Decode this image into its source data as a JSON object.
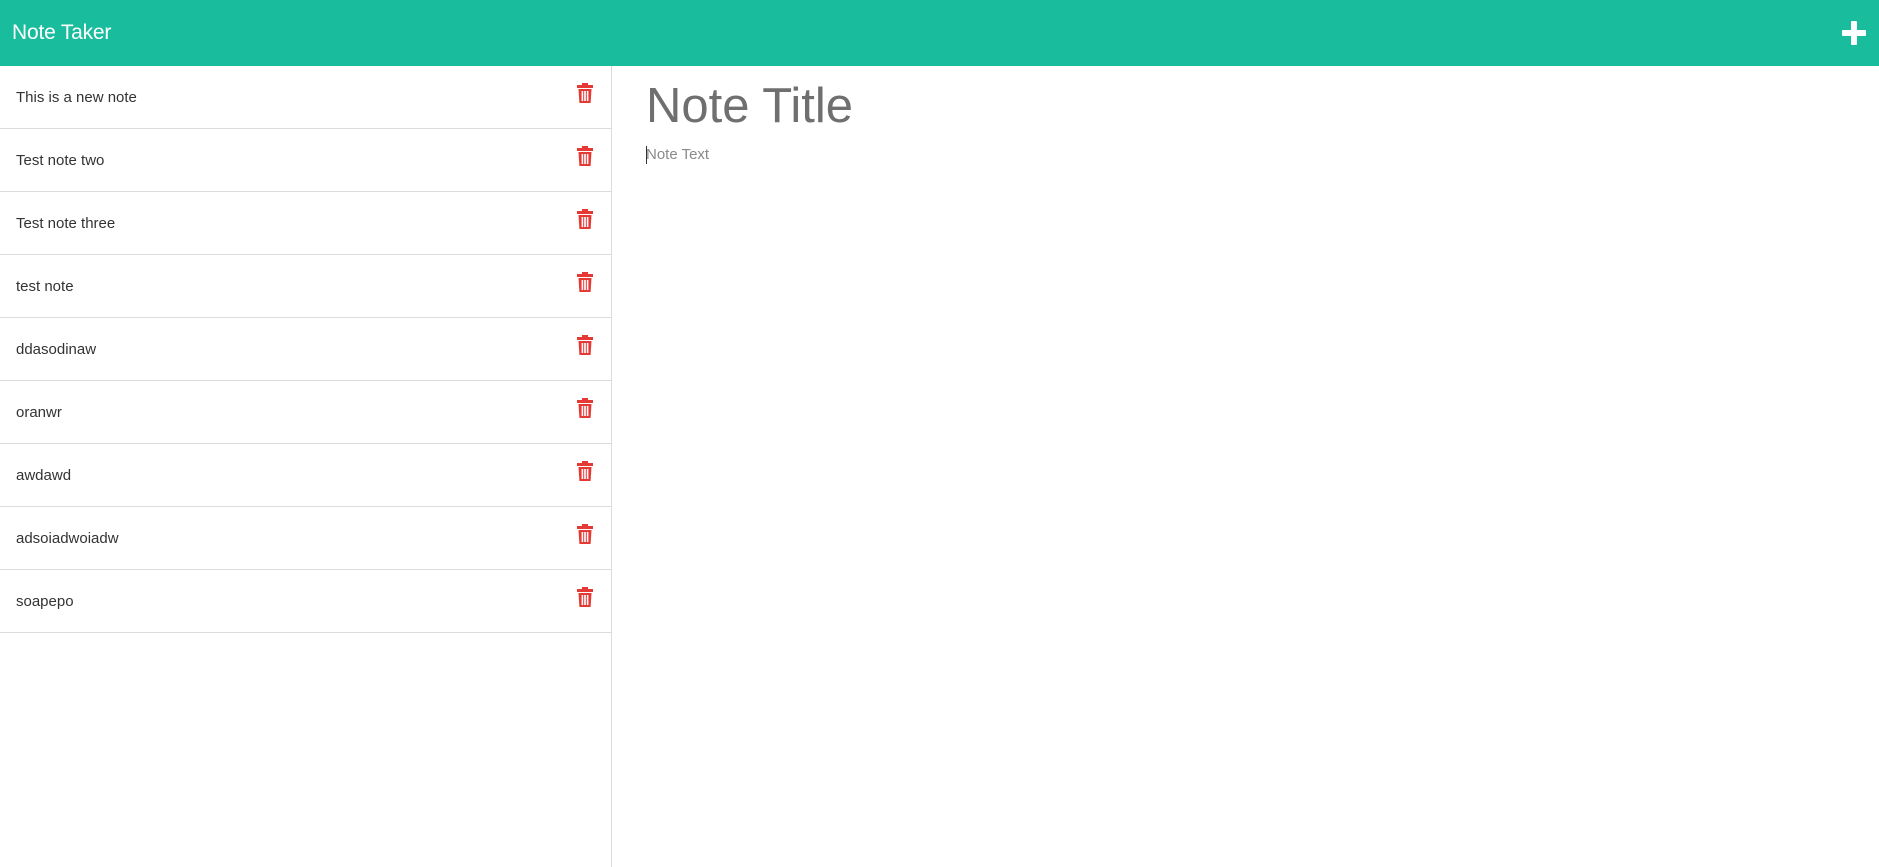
{
  "navbar": {
    "brand": "Note Taker",
    "accent_color": "#19bd9d",
    "new_note_icon": "plus-icon"
  },
  "sidebar": {
    "delete_icon": "trash-icon",
    "delete_color": "#e53935",
    "notes": [
      {
        "title": "This is a new note"
      },
      {
        "title": "Test note two"
      },
      {
        "title": "Test note three"
      },
      {
        "title": "test note"
      },
      {
        "title": "ddasodinaw"
      },
      {
        "title": "oranwr"
      },
      {
        "title": "awdawd"
      },
      {
        "title": "adsoiadwoiadw"
      },
      {
        "title": "soapepo"
      }
    ]
  },
  "editor": {
    "title_placeholder": "Note Title",
    "title_value": "",
    "text_placeholder": "Note Text",
    "text_value": ""
  }
}
